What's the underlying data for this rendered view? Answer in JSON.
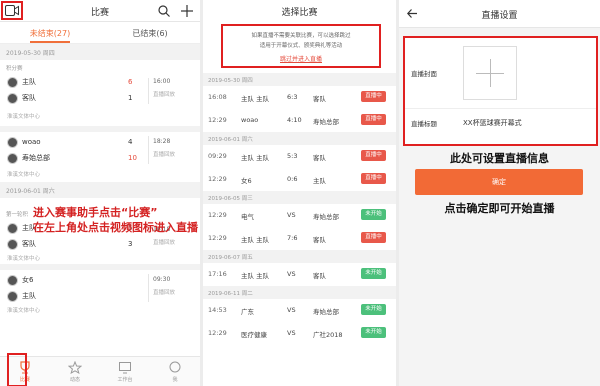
{
  "p1": {
    "title": "比赛",
    "tabs": [
      "未结束(27)",
      "已结束(6)"
    ],
    "dates": [
      "2019-05-30 周四",
      "2019-06-01 周六"
    ],
    "group1": "积分赛",
    "group2": "第一轮积",
    "matches": [
      {
        "home": "主队",
        "away": "客队",
        "hs": "6",
        "as": "1",
        "time": "16:00",
        "status": "直播回放",
        "venue": "淮溪文体中心"
      },
      {
        "home": "woao",
        "away": "寿始总部",
        "hs": "4",
        "as": "10",
        "time": "18:28",
        "status": "直播回放",
        "venue": "淮溪文体中心"
      },
      {
        "home": "主队",
        "away": "客队",
        "hs": "5",
        "as": "3",
        "time": "16:18",
        "status": "直播回放",
        "venue": "淮溪文体中心"
      },
      {
        "home": "女6",
        "away": "主队",
        "hs": "",
        "as": "",
        "time": "09:30",
        "status": "直播回放",
        "venue": "淮溪文体中心"
      }
    ],
    "callout1": "进入赛事助手点击“比赛”",
    "callout2": "在左上角处点击视频图标进入直播",
    "nav": [
      "比赛",
      "动态",
      "工作台",
      "我"
    ]
  },
  "p2": {
    "title": "选择比赛",
    "notice_l1": "如果直播不需要关联比赛，可以选择跳过",
    "notice_l2": "适用于开幕仪式、颁奖典礼等活动",
    "notice_link": "跳过并进入直播",
    "rows": [
      {
        "type": "date",
        "text": "2019-05-30 周四"
      },
      {
        "type": "m",
        "t": "16:08",
        "h": "主队 主队",
        "s": "6:3",
        "a": "客队",
        "st": "直播中",
        "k": "live"
      },
      {
        "type": "m",
        "t": "12:29",
        "h": "woao",
        "s": "4:10",
        "a": "寿始总部",
        "st": "直播中",
        "k": "live"
      },
      {
        "type": "date",
        "text": "2019-06-01 周六"
      },
      {
        "type": "m",
        "t": "09:29",
        "h": "主队 主队",
        "s": "5:3",
        "a": "客队",
        "st": "直播中",
        "k": "live"
      },
      {
        "type": "m",
        "t": "12:29",
        "h": "女6",
        "s": "0:6",
        "a": "主队",
        "st": "直播中",
        "k": "live"
      },
      {
        "type": "date",
        "text": "2019-06-05 周三"
      },
      {
        "type": "m",
        "t": "12:29",
        "h": "电气",
        "s": "VS",
        "a": "寿始总部",
        "st": "未开始",
        "k": "notyet"
      },
      {
        "type": "m",
        "t": "12:29",
        "h": "主队 主队",
        "s": "7:6",
        "a": "客队",
        "st": "直播中",
        "k": "live"
      },
      {
        "type": "date",
        "text": "2019-06-07 周五"
      },
      {
        "type": "m",
        "t": "17:16",
        "h": "主队 主队",
        "s": "VS",
        "a": "客队",
        "st": "未开始",
        "k": "notyet"
      },
      {
        "type": "date",
        "text": "2019-06-11 周二"
      },
      {
        "type": "m",
        "t": "14:53",
        "h": "广东",
        "s": "VS",
        "a": "寿始总部",
        "st": "未开始",
        "k": "notyet"
      },
      {
        "type": "m",
        "t": "12:29",
        "h": "医疗健康",
        "s": "VS",
        "a": "广社2018",
        "st": "未开始",
        "k": "notyet"
      }
    ]
  },
  "p3": {
    "title": "直播设置",
    "cover_label": "直播封面",
    "title_label": "直播标题",
    "title_value": "XX杯篮球赛开幕式",
    "hint1": "此处可设置直播信息",
    "confirm": "确定",
    "hint2": "点击确定即可开始直播"
  },
  "colors": {
    "accent": "#f06f3a",
    "highlight": "#e02020",
    "live": "#e8584a",
    "notyet": "#4cc07b"
  }
}
